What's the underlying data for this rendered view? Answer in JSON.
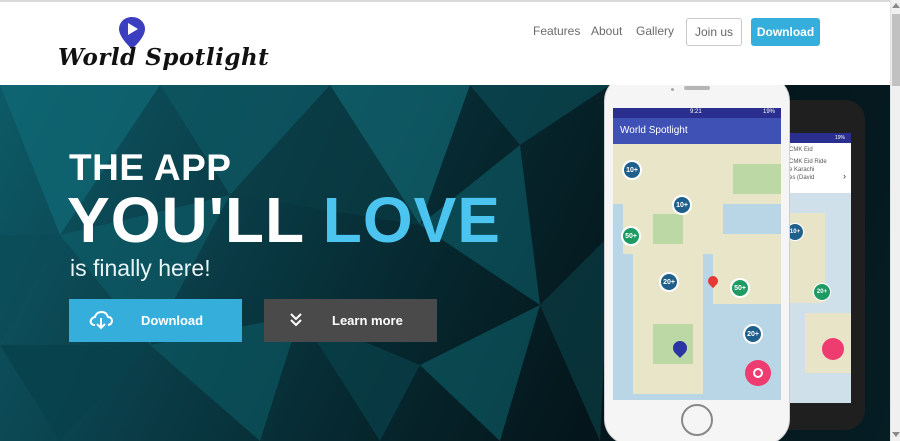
{
  "brand": {
    "name": "World Spotlight",
    "pin_color": "#3b3fbf"
  },
  "nav": {
    "links": [
      "Features",
      "About",
      "Gallery"
    ],
    "join_label": "Join us",
    "download_label": "Download",
    "accent": "#36aedb"
  },
  "hero": {
    "line1": "THE APP",
    "line2_white": "YOU'LL",
    "line2_accent": "LOVE",
    "subline": "is finally here!",
    "download_label": "Download",
    "learn_more_label": "Learn more",
    "accent": "#4cc4f0",
    "download_icon": "cloud-download-icon",
    "learn_more_icon": "double-chevron-down-icon"
  },
  "phone_front": {
    "status_time": "9:21",
    "status_battery": "19%",
    "app_title": "World Spotlight",
    "clusters": [
      "10+",
      "10+",
      "50+",
      "20+",
      "50+",
      "20+"
    ]
  },
  "phone_back": {
    "status_battery": "19%",
    "list_items": [
      "CMK Eid",
      "CMK Eid Ride",
      "e Karachi",
      "es (David"
    ],
    "clusters": [
      "10+",
      "20+"
    ]
  }
}
